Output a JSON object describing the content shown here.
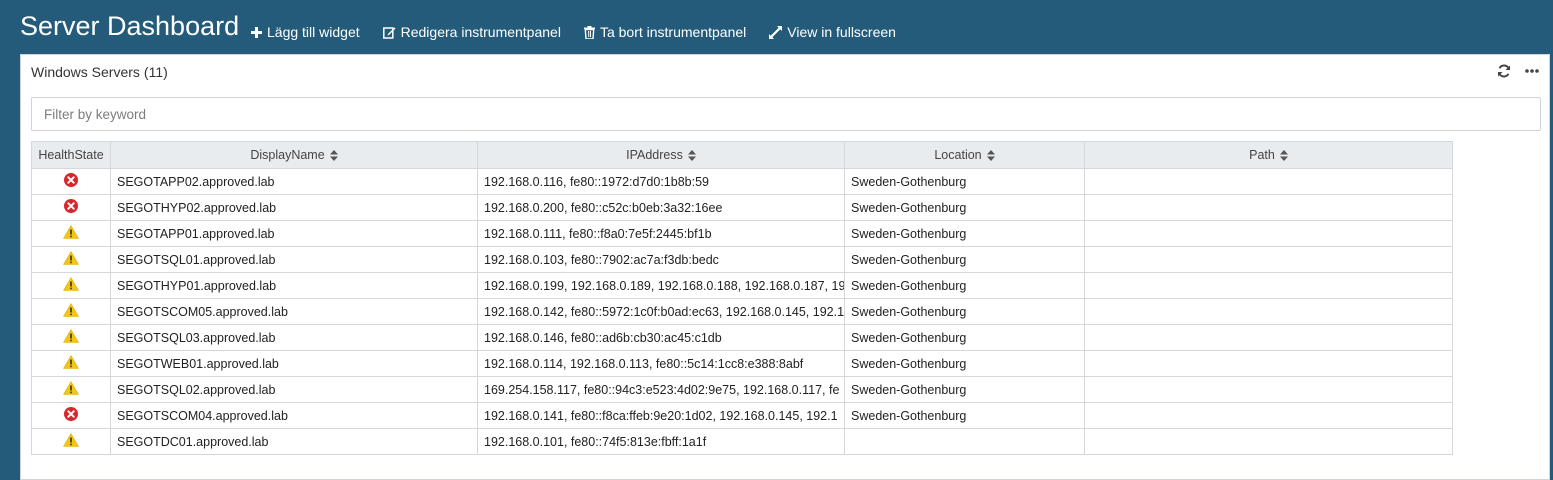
{
  "header": {
    "title": "Server Dashboard",
    "actions": [
      {
        "label": "Lägg till widget",
        "icon": "plus-icon"
      },
      {
        "label": "Redigera instrumentpanel",
        "icon": "edit-icon"
      },
      {
        "label": "Ta bort instrumentpanel",
        "icon": "trash-icon"
      },
      {
        "label": "View in fullscreen",
        "icon": "expand-icon"
      }
    ]
  },
  "widget": {
    "title": "Windows Servers",
    "count": "(11)",
    "icons": [
      "refresh-icon",
      "more-icon"
    ],
    "filter_placeholder": "Filter by keyword",
    "filter_value": "",
    "columns": [
      "HealthState",
      "DisplayName",
      "IPAddress",
      "Location",
      "Path"
    ],
    "rows": [
      {
        "health": "critical",
        "name": "SEGOTAPP02.approved.lab",
        "ip": "192.168.0.116, fe80::1972:d7d0:1b8b:59",
        "location": "Sweden-Gothenburg",
        "path": ""
      },
      {
        "health": "critical",
        "name": "SEGOTHYP02.approved.lab",
        "ip": "192.168.0.200, fe80::c52c:b0eb:3a32:16ee",
        "location": "Sweden-Gothenburg",
        "path": ""
      },
      {
        "health": "warning",
        "name": "SEGOTAPP01.approved.lab",
        "ip": "192.168.0.111, fe80::f8a0:7e5f:2445:bf1b",
        "location": "Sweden-Gothenburg",
        "path": ""
      },
      {
        "health": "warning",
        "name": "SEGOTSQL01.approved.lab",
        "ip": "192.168.0.103, fe80::7902:ac7a:f3db:bedc",
        "location": "Sweden-Gothenburg",
        "path": ""
      },
      {
        "health": "warning",
        "name": "SEGOTHYP01.approved.lab",
        "ip": "192.168.0.199, 192.168.0.189, 192.168.0.188, 192.168.0.187, 19",
        "location": "Sweden-Gothenburg",
        "path": ""
      },
      {
        "health": "warning",
        "name": "SEGOTSCOM05.approved.lab",
        "ip": "192.168.0.142, fe80::5972:1c0f:b0ad:ec63, 192.168.0.145, 192.1",
        "location": "Sweden-Gothenburg",
        "path": ""
      },
      {
        "health": "warning",
        "name": "SEGOTSQL03.approved.lab",
        "ip": "192.168.0.146, fe80::ad6b:cb30:ac45:c1db",
        "location": "Sweden-Gothenburg",
        "path": ""
      },
      {
        "health": "warning",
        "name": "SEGOTWEB01.approved.lab",
        "ip": "192.168.0.114, 192.168.0.113, fe80::5c14:1cc8:e388:8abf",
        "location": "Sweden-Gothenburg",
        "path": ""
      },
      {
        "health": "warning",
        "name": "SEGOTSQL02.approved.lab",
        "ip": "169.254.158.117, fe80::94c3:e523:4d02:9e75, 192.168.0.117, fe",
        "location": "Sweden-Gothenburg",
        "path": ""
      },
      {
        "health": "critical",
        "name": "SEGOTSCOM04.approved.lab",
        "ip": "192.168.0.141, fe80::f8ca:ffeb:9e20:1d02, 192.168.0.145, 192.1",
        "location": "Sweden-Gothenburg",
        "path": ""
      },
      {
        "health": "warning",
        "name": "SEGOTDC01.approved.lab",
        "ip": "192.168.0.101, fe80::74f5:813e:fbff:1a1f",
        "location": "",
        "path": ""
      }
    ]
  },
  "colors": {
    "background": "#255b7a",
    "critical": "#d9262c",
    "warning": "#f2c518"
  }
}
